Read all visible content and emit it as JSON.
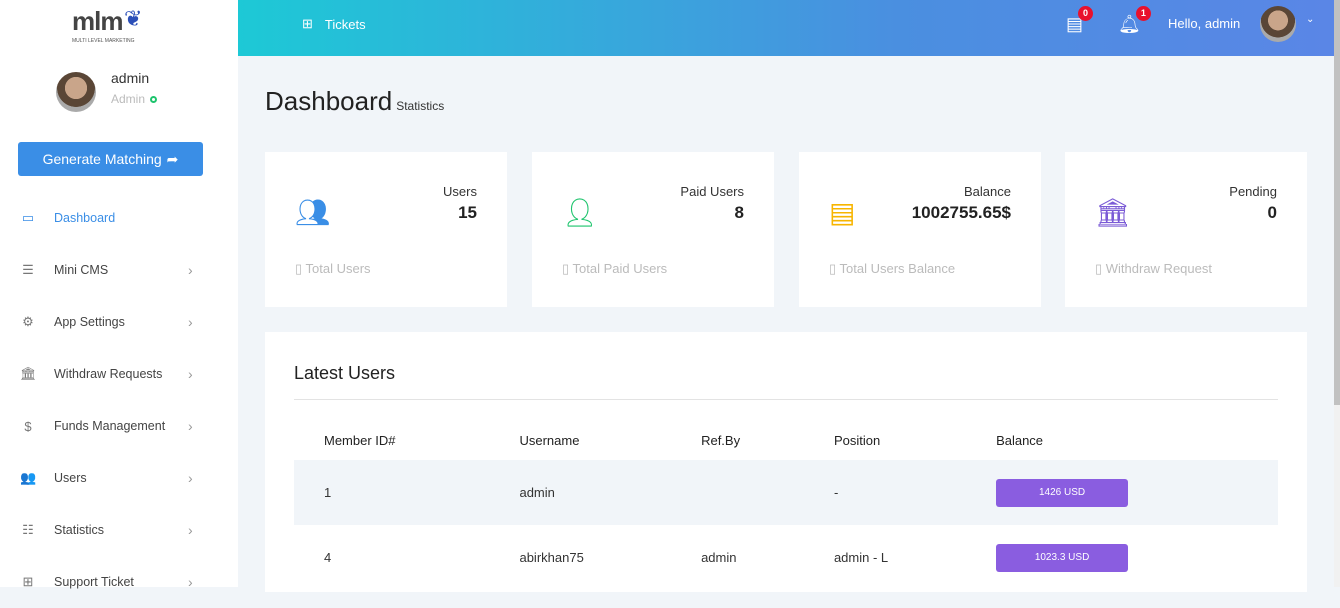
{
  "logo": {
    "text": "mlm",
    "subtitle": "MULTI LEVEL MARKETING"
  },
  "profile": {
    "name": "admin",
    "role": "Admin"
  },
  "generate_button": "Generate Matching",
  "nav": [
    {
      "label": "Dashboard",
      "icon": "monitor-icon",
      "active": true
    },
    {
      "label": "Mini CMS",
      "icon": "menu-icon"
    },
    {
      "label": "App Settings",
      "icon": "gear-icon"
    },
    {
      "label": "Withdraw Requests",
      "icon": "bank-icon"
    },
    {
      "label": "Funds Management",
      "icon": "money-icon"
    },
    {
      "label": "Users",
      "icon": "users-icon"
    },
    {
      "label": "Statistics",
      "icon": "list-icon"
    },
    {
      "label": "Support Ticket",
      "icon": "ticket-icon"
    }
  ],
  "topbar": {
    "tickets": "Tickets",
    "doc_badge": "0",
    "bell_badge": "1",
    "greeting": "Hello, admin"
  },
  "page": {
    "title": "Dashboard",
    "subtitle": "Statistics"
  },
  "cards": [
    {
      "label": "Users",
      "value": "15",
      "footer": "Total Users",
      "color": "#3a8ee6"
    },
    {
      "label": "Paid Users",
      "value": "8",
      "footer": "Total Paid Users",
      "color": "#1ec46d"
    },
    {
      "label": "Balance",
      "value": "1002755.65$",
      "footer": "Total Users Balance",
      "color": "#f7b500"
    },
    {
      "label": "Pending",
      "value": "0",
      "footer": "Withdraw Request",
      "color": "#7b5bd6"
    }
  ],
  "latest": {
    "title": "Latest Users",
    "columns": [
      "Member ID#",
      "Username",
      "Ref.By",
      "Position",
      "Balance"
    ],
    "rows": [
      [
        "1",
        "admin",
        "",
        "-",
        "1426 USD"
      ],
      [
        "4",
        "abirkhan75",
        "admin",
        "admin - L",
        "1023.3 USD"
      ]
    ]
  }
}
